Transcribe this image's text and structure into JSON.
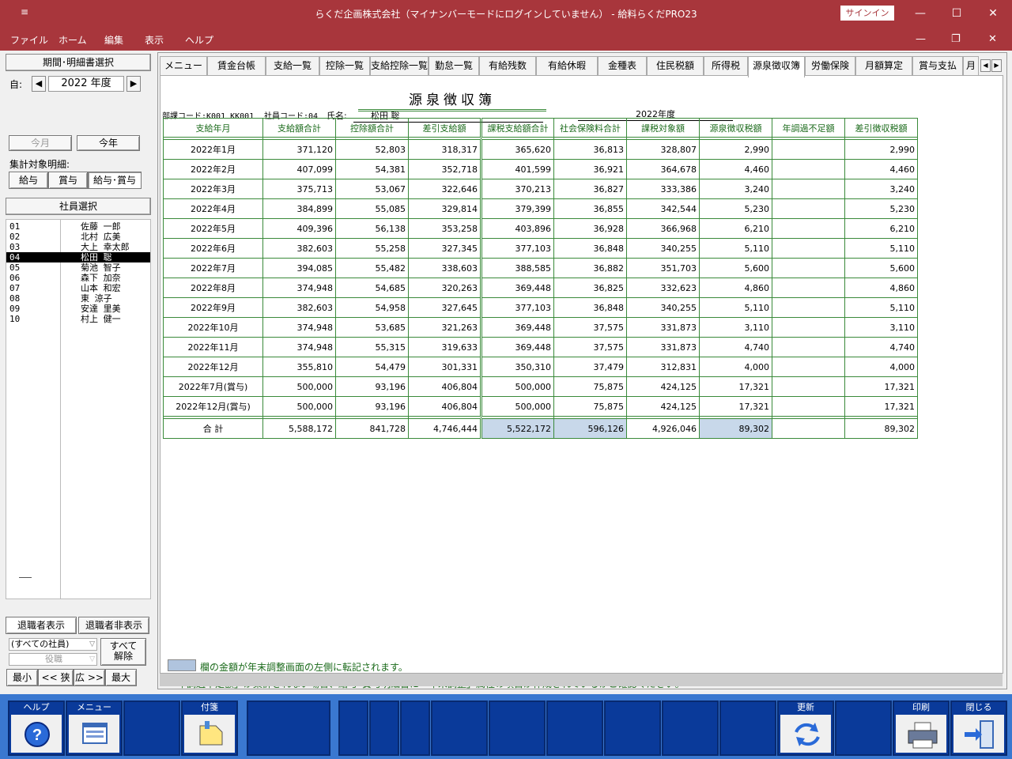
{
  "title": {
    "app_icon": "≡",
    "text": "らくだ企画株式会社（マイナンバーモードにログインしていません） -  給料らくだPRO23",
    "signin": "サインイン",
    "minimize": "—",
    "maximize": "☐",
    "close": "✕"
  },
  "menu": {
    "items": [
      "ファイル",
      "ホーム",
      "編集",
      "表示",
      "ヘルプ"
    ],
    "min": "—",
    "restore": "❐",
    "close": "✕"
  },
  "left": {
    "period_header": "期間･明細書選択",
    "from_label": "自:",
    "year": "2022 年度",
    "this_month": "今月",
    "this_year": "今年",
    "aggregate_label": "集計対象明細:",
    "seg": [
      "給与",
      "賞与",
      "給与･賞与"
    ],
    "emp_header": "社員選択",
    "employees": [
      {
        "code": "01",
        "name": "佐藤 一郎"
      },
      {
        "code": "02",
        "name": "北村 広美"
      },
      {
        "code": "03",
        "name": "大上 幸太郎"
      },
      {
        "code": "04",
        "name": "松田 聡"
      },
      {
        "code": "05",
        "name": "菊池 智子"
      },
      {
        "code": "06",
        "name": "森下 加奈"
      },
      {
        "code": "07",
        "name": "山本 和宏"
      },
      {
        "code": "08",
        "name": "東 涼子"
      },
      {
        "code": "09",
        "name": "安達 里美"
      },
      {
        "code": "10",
        "name": "村上 健一"
      }
    ],
    "selected_index": 3,
    "retired_show": "退職者表示",
    "retired_hide": "退職者非表示",
    "combo_all": "(すべての社員)",
    "combo_role": "役職",
    "clear_all_1": "すべて",
    "clear_all_2": "解除",
    "nav": [
      "最小",
      "<< 狭",
      "広 >>",
      "最大"
    ]
  },
  "tabs": [
    "メニュー",
    "賃金台帳",
    "支給一覧",
    "控除一覧",
    "支給控除一覧",
    "勤怠一覧",
    "有給残数",
    "有給休暇",
    "金種表",
    "住民税額",
    "所得税",
    "源泉徴収簿",
    "労働保険",
    "月額算定",
    "賞与支払",
    "月"
  ],
  "active_tab": 11,
  "doc": {
    "title": "源泉徴収簿",
    "dept_label": "部課コード:K001 KK001",
    "emp_code_label": "社員コード:04",
    "name_label": "氏名:",
    "name": "松田 聡",
    "fiscal_year": "2022年度",
    "columns": [
      "支給年月",
      "支給額合計",
      "控除額合計",
      "差引支給額",
      "課税支給額合計",
      "社会保険料合計",
      "課税対象額",
      "源泉徴収税額",
      "年調過不足額",
      "差引徴収税額"
    ],
    "rows": [
      [
        "2022年1月",
        "371,120",
        "52,803",
        "318,317",
        "365,620",
        "36,813",
        "328,807",
        "2,990",
        "",
        "2,990"
      ],
      [
        "2022年2月",
        "407,099",
        "54,381",
        "352,718",
        "401,599",
        "36,921",
        "364,678",
        "4,460",
        "",
        "4,460"
      ],
      [
        "2022年3月",
        "375,713",
        "53,067",
        "322,646",
        "370,213",
        "36,827",
        "333,386",
        "3,240",
        "",
        "3,240"
      ],
      [
        "2022年4月",
        "384,899",
        "55,085",
        "329,814",
        "379,399",
        "36,855",
        "342,544",
        "5,230",
        "",
        "5,230"
      ],
      [
        "2022年5月",
        "409,396",
        "56,138",
        "353,258",
        "403,896",
        "36,928",
        "366,968",
        "6,210",
        "",
        "6,210"
      ],
      [
        "2022年6月",
        "382,603",
        "55,258",
        "327,345",
        "377,103",
        "36,848",
        "340,255",
        "5,110",
        "",
        "5,110"
      ],
      [
        "2022年7月",
        "394,085",
        "55,482",
        "338,603",
        "388,585",
        "36,882",
        "351,703",
        "5,600",
        "",
        "5,600"
      ],
      [
        "2022年8月",
        "374,948",
        "54,685",
        "320,263",
        "369,448",
        "36,825",
        "332,623",
        "4,860",
        "",
        "4,860"
      ],
      [
        "2022年9月",
        "382,603",
        "54,958",
        "327,645",
        "377,103",
        "36,848",
        "340,255",
        "5,110",
        "",
        "5,110"
      ],
      [
        "2022年10月",
        "374,948",
        "53,685",
        "321,263",
        "369,448",
        "37,575",
        "331,873",
        "3,110",
        "",
        "3,110"
      ],
      [
        "2022年11月",
        "374,948",
        "55,315",
        "319,633",
        "369,448",
        "37,575",
        "331,873",
        "4,740",
        "",
        "4,740"
      ],
      [
        "2022年12月",
        "355,810",
        "54,479",
        "301,331",
        "350,310",
        "37,479",
        "312,831",
        "4,000",
        "",
        "4,000"
      ],
      [
        "2022年7月(賞与)",
        "500,000",
        "93,196",
        "406,804",
        "500,000",
        "75,875",
        "424,125",
        "17,321",
        "",
        "17,321"
      ],
      [
        "2022年12月(賞与)",
        "500,000",
        "93,196",
        "406,804",
        "500,000",
        "75,875",
        "424,125",
        "17,321",
        "",
        "17,321"
      ]
    ],
    "total": [
      "合 計",
      "5,588,172",
      "841,728",
      "4,746,444",
      "5,522,172",
      "596,126",
      "4,926,046",
      "89,302",
      "",
      "89,302"
    ],
    "note1": "欄の金額が年末調整画面の左側に転記されます。",
    "note2": "「年調過不足額」が集計されない場合、給与･賞与明細書に「年末調整」属性の項目が作成されているかご確認ください。"
  },
  "toolbar": {
    "help": "ヘルプ",
    "menu": "メニュー",
    "tag": "付箋",
    "update": "更新",
    "print": "印刷",
    "close": "閉じる"
  },
  "colors": {
    "titlebar": "#a8363c",
    "grid": "#3a8a3a",
    "highlight": "#c8d8ea",
    "toolbar": "#3a78d0"
  }
}
